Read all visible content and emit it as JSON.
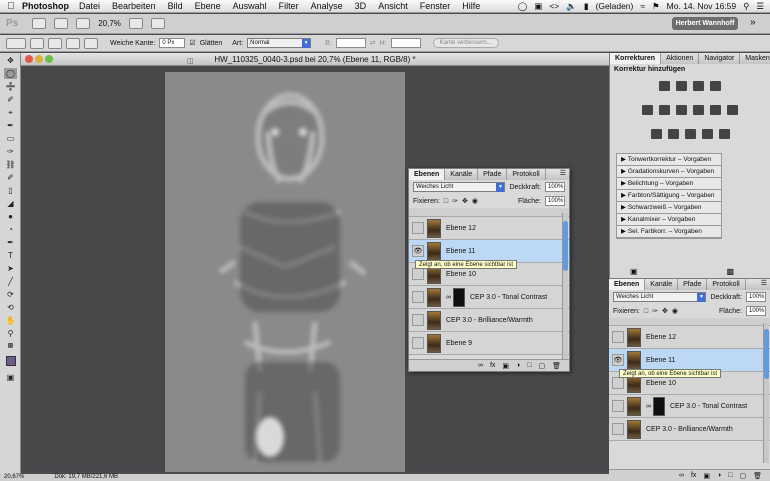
{
  "menubar": {
    "app_name": "Photoshop",
    "items": [
      "Datei",
      "Bearbeiten",
      "Bild",
      "Ebene",
      "Auswahl",
      "Filter",
      "Analyse",
      "3D",
      "Ansicht",
      "Fenster",
      "Hilfe"
    ],
    "battery": "(Geladen)",
    "datetime": "Mo. 14. Nov 16:59"
  },
  "appbar": {
    "logo": "Ps",
    "zoom": "20,7%",
    "user": "Herbert Wannhoff"
  },
  "options": {
    "feather_label": "Weiche Kante:",
    "feather_value": "0 Px",
    "antialias_label": "Glätten",
    "style_label": "Art:",
    "style_value": "Normal",
    "width_label": "B:",
    "height_label": "H:",
    "refine_button": "Kante verbessern..."
  },
  "document": {
    "title": "HW_110325_0040-3.psd bei 20,7% (Ebene 11, RGB/8) *"
  },
  "status": {
    "zoom": "20,67%",
    "doc_size": "Dok: 19,7 MB/221,6 MB"
  },
  "layers_panel": {
    "tabs": [
      "Ebenen",
      "Kanäle",
      "Pfade",
      "Protokoll"
    ],
    "blend_mode": "Weiches Licht",
    "opacity_label": "Deckkraft:",
    "opacity_value": "100%",
    "lock_label": "Fixieren:",
    "fill_label": "Fläche:",
    "fill_value": "100%",
    "rows": [
      {
        "name": "Ebene 12",
        "selected": false,
        "mask": false,
        "visible": false
      },
      {
        "name": "Ebene 11",
        "selected": true,
        "mask": false,
        "visible": true
      },
      {
        "name": "Ebene 10",
        "selected": false,
        "mask": false,
        "visible": false
      },
      {
        "name": "CEP 3.0 - Tonal Contrast",
        "selected": false,
        "mask": true,
        "visible": false
      },
      {
        "name": "CEP 3.0 - Brilliance/Warmth",
        "selected": false,
        "mask": false,
        "visible": false
      },
      {
        "name": "Ebene 9",
        "selected": false,
        "mask": false,
        "visible": false
      }
    ],
    "tooltip": "Zeigt an, ob eine Ebene sichtbar ist"
  },
  "adjustments_panel": {
    "tabs": [
      "Korrekturen",
      "Aktionen",
      "Navigator",
      "Masken"
    ],
    "heading": "Korrektur hinzufügen",
    "presets": [
      "Tonwertkorrektur – Vorgaben",
      "Gradationskurven – Vorgaben",
      "Belichtung – Vorgaben",
      "Farbton/Sättigung – Vorgaben",
      "Schwarzweiß – Vorgaben",
      "Kanalmixer – Vorgaben",
      "Sel. Farbkorr. – Vorgaben"
    ]
  },
  "colors": {
    "foreground": "#6e5e86",
    "selection": "#bcd8f4",
    "accent": "#3f6fd6"
  }
}
